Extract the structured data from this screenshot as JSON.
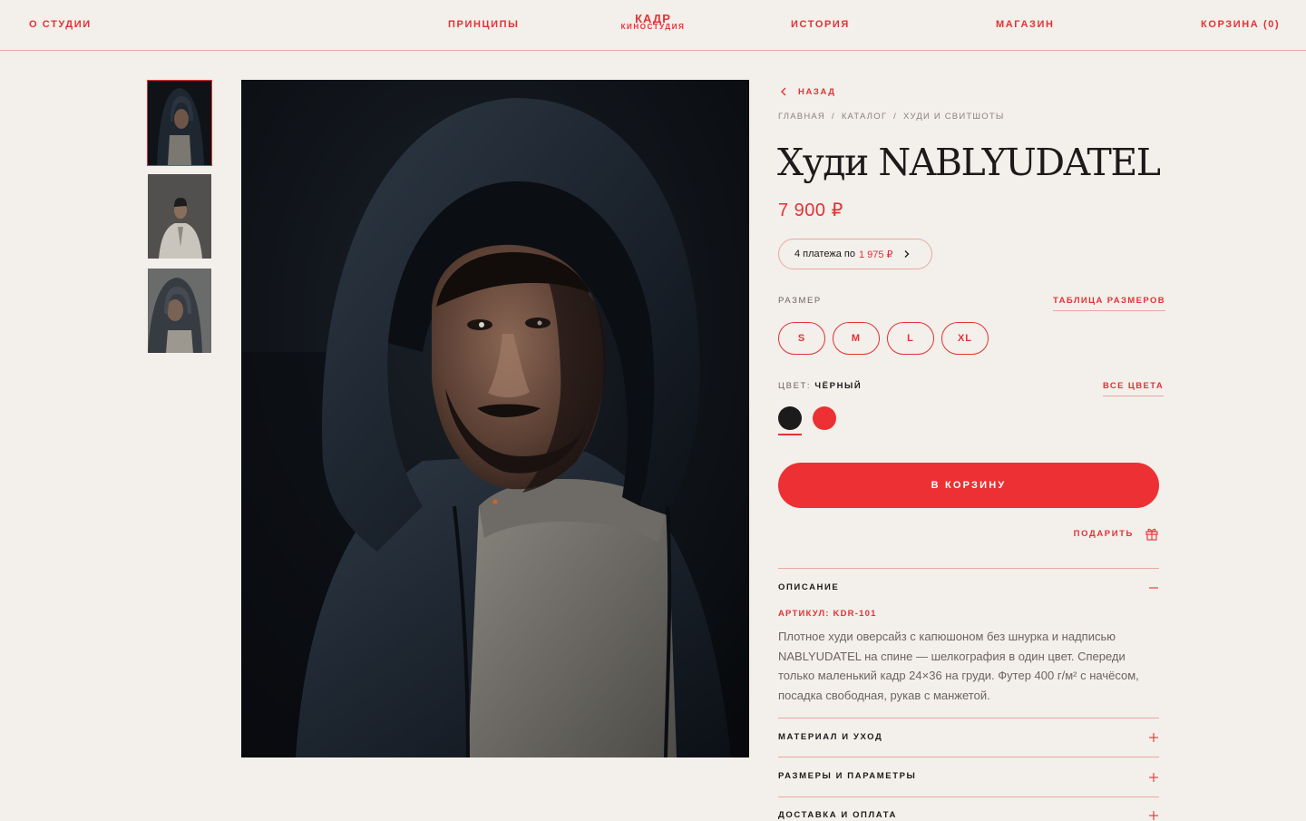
{
  "nav": {
    "about": "О СТУДИИ",
    "principles": "ПРИНЦИПЫ",
    "logo_main": "КАДР",
    "logo_sub": "КИНОСТУДИЯ",
    "history": "ИСТОРИЯ",
    "shop": "МАГАЗИН",
    "cart": "КОРЗИНА (0)"
  },
  "gallery": {
    "thumbnails": [
      "thumb-1",
      "thumb-2",
      "thumb-3"
    ],
    "active_index": 0
  },
  "product": {
    "back_label": "НАЗАД",
    "breadcrumb": [
      "ГЛАВНАЯ",
      "КАТАЛОГ",
      "ХУДИ И СВИТШОТЫ"
    ],
    "breadcrumb_sep": "/",
    "title": "Худи NABLYUDATEL",
    "price": "7 900 ₽",
    "installments_text": "4 платежа по",
    "installments_amount": "1 975 ₽",
    "size_label": "РАЗМЕР",
    "size_chart_link": "ТАБЛИЦА РАЗМЕРОВ",
    "sizes": [
      "S",
      "M",
      "L",
      "XL"
    ],
    "color_label": "ЦВЕТ:",
    "color_value": "ЧЁРНЫЙ",
    "all_colors_link": "ВСЕ ЦВЕТА",
    "colors": [
      {
        "name": "black",
        "hex": "#1c1a1a"
      },
      {
        "name": "red",
        "hex": "#ec3033"
      }
    ],
    "selected_color": "black",
    "add_to_cart": "В КОРЗИНУ",
    "gift_label": "ПОДАРИТЬ"
  },
  "accordion": {
    "description_title": "ОПИСАНИЕ",
    "sku": "АРТИКУЛ: KDR-101",
    "description_text": "Плотное худи оверсайз с капюшоном без шнурка и надписью NABLYUDATEL на спине — шелкография в один цвет. Спереди только маленький кадр 24×36 на груди. Футер 400 г/м² с начёсом, посадка свободная, рукав с манжетой.",
    "material_title": "МАТЕРИАЛ И УХОД",
    "sizes_title": "РАЗМЕРЫ И ПАРАМЕТРЫ",
    "delivery_title": "ДОСТАВКА И ОПЛАТА"
  },
  "colors": {
    "accent": "#e33236",
    "button": "#ec3033",
    "background": "#f3efea",
    "divider": "#e8a8a4"
  }
}
